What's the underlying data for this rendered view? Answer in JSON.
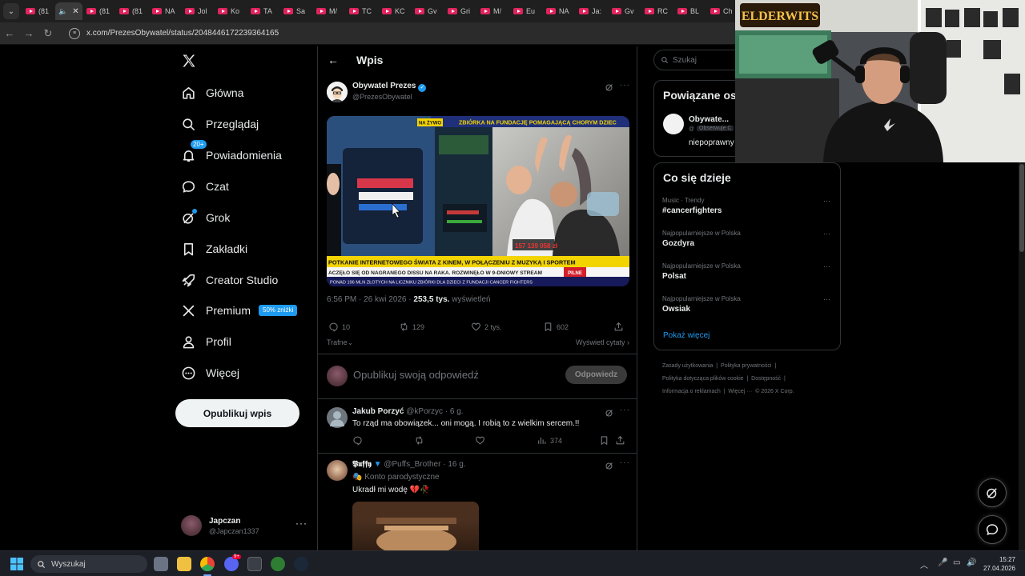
{
  "browser": {
    "tabs": [
      "(81",
      "",
      "(81",
      "(81",
      "NA",
      "Jol",
      "Ko",
      "TA",
      "Sa",
      "M/",
      "TC",
      "KC",
      "Gv",
      "Gri",
      "M/",
      "Eu",
      "NA",
      "Ja:",
      "Gv",
      "RC",
      "BL",
      "Ch"
    ],
    "active_tab_index": 1,
    "url": "x.com/PrezesObywatel/status/2048446172239364165"
  },
  "nav": {
    "items": [
      {
        "label": "Główna",
        "icon": "home-icon"
      },
      {
        "label": "Przeglądaj",
        "icon": "search-icon"
      },
      {
        "label": "Powiadomienia",
        "icon": "bell-icon",
        "badge": "20+"
      },
      {
        "label": "Czat",
        "icon": "chat-icon"
      },
      {
        "label": "Grok",
        "icon": "grok-icon"
      },
      {
        "label": "Zakładki",
        "icon": "bookmark-icon"
      },
      {
        "label": "Creator Studio",
        "icon": "rocket-icon"
      },
      {
        "label": "Premium",
        "icon": "x-icon",
        "badge": "50% zniżki"
      },
      {
        "label": "Profil",
        "icon": "person-icon"
      },
      {
        "label": "Więcej",
        "icon": "more-circle-icon"
      }
    ],
    "post_button": "Opublikuj wpis",
    "account": {
      "name": "Japczan",
      "handle": "@Japczan1337"
    }
  },
  "main": {
    "header_title": "Wpis",
    "post": {
      "author_name": "Obywatel Prezes",
      "author_handle": "@PrezesObywatel",
      "media_text": {
        "live": "NA ŻYWO",
        "top_banner": "ZBIÓRKA NA FUNDACJĘ POMAGAJĄCĄ CHORYM DZIEC",
        "counter": "157 139 058 zł",
        "bottom_line1": "POTKANIE INTERNETOWEGO ŚWIATA Z KINEM, W POŁĄCZENIU Z MUZYKĄ I SPORTEM",
        "bottom_line2": "ACZĘŁO SIĘ OD NAGRANEGO DISSU NA RAKA. ROZWINĘŁO W 9-DNIOWY STREAM",
        "bottom_line3": "PONAD 196 MLN ZŁOTYCH NA LICZNIKU ZBIÓRKI DLA DZIECI Z FUNDACJI CANCER FIGHTERS",
        "pilne": "PILNE"
      },
      "time": "6:56 PM · 26 kwi 2026 · ",
      "views_count": "253,5 tys.",
      "views_label": " wyświetleń",
      "stats": {
        "replies": "10",
        "reposts": "129",
        "likes": "2 tys.",
        "bookmarks": "602"
      },
      "sort_label": "Trafne",
      "view_quotes": "Wyświetl cytaty"
    },
    "reply_box": {
      "placeholder": "Opublikuj swoją odpowiedź",
      "button": "Odpowiedz"
    },
    "replies": [
      {
        "name": "Jakub Porzyć",
        "handle": "@kPorzyc · 6 g.",
        "text": "To rząd ma obowiązek... oni mogą. I robią to z wielkim sercem.!!",
        "views": "374"
      },
      {
        "name": "𝕻𝖚𝖋𝖋𝖞",
        "handle": "@Puffs_Brother · 16 g.",
        "parody_label": "Konto parodystyczne",
        "text": "Ukradł mi wodę 💔🥀"
      }
    ]
  },
  "sidebar": {
    "search_placeholder": "Szukaj",
    "related_title": "Powiązane os",
    "related_account": {
      "name": "Obywate...",
      "handle": "@",
      "follow_badge": "Obserwuje C",
      "bio": "niepoprawny"
    },
    "trends_title": "Co się dzieje",
    "trends": [
      {
        "category": "Music · Trendy",
        "name": "#cancerfighters"
      },
      {
        "category": "Najpopularniejsze w Polska",
        "name": "Gozdyra"
      },
      {
        "category": "Najpopularniejsze w Polska",
        "name": "Polsat"
      },
      {
        "category": "Najpopularniejsze w Polska",
        "name": "Owsiak"
      }
    ],
    "show_more": "Pokaż więcej",
    "footer": {
      "l1": "Zasady użytkowania",
      "l2": "Polityka prywatności",
      "l3": "Polityka dotycząca plików cookie",
      "l4": "Dostępność",
      "l5": "Informacja o reklamach",
      "l6": "Więcej ···",
      "l7": "© 2026 X Corp."
    }
  },
  "webcam": {
    "sign": "ELDERWITS"
  },
  "taskbar": {
    "search": "Wyszukaj",
    "time": "15:27",
    "date": "27.04.2026",
    "discord_badge": "9+"
  },
  "colors": {
    "accent": "#1d9bf0",
    "bg": "#000000",
    "border": "#2f3336",
    "muted": "#71767b"
  }
}
